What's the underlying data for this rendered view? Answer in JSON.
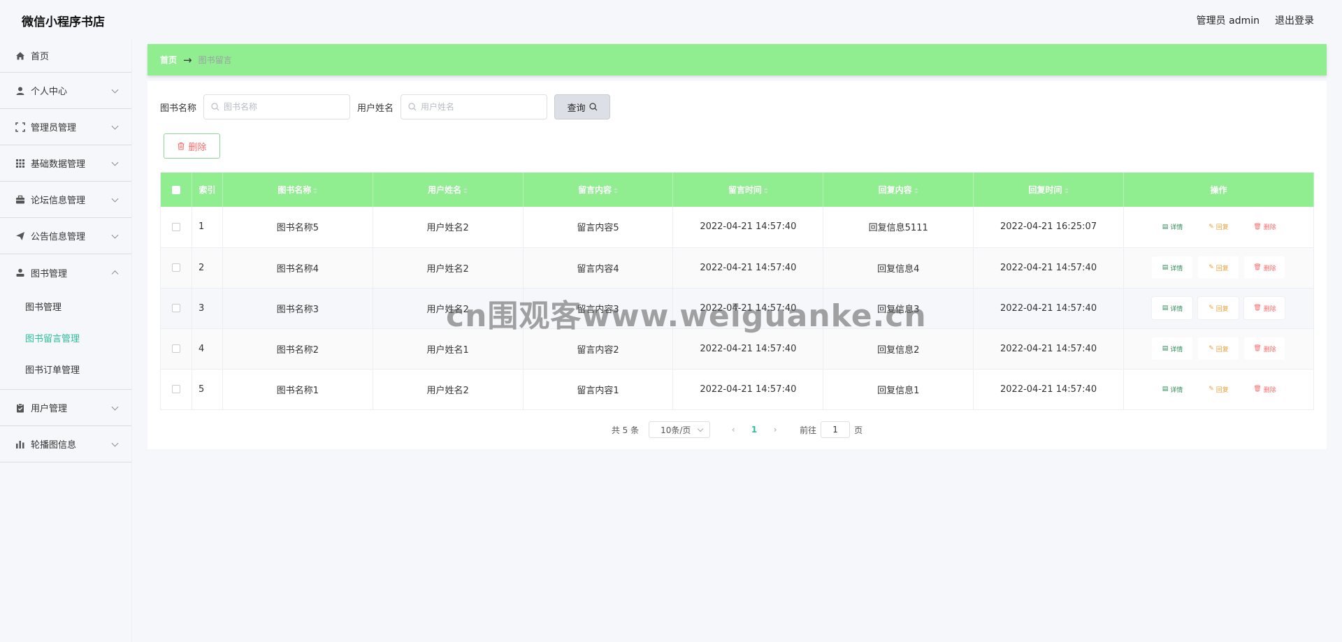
{
  "app": {
    "title": "微信小程序书店"
  },
  "header": {
    "user_label": "管理员 admin",
    "logout_label": "退出登录"
  },
  "sidebar": {
    "items": [
      {
        "label": "首页",
        "icon": "home-icon"
      },
      {
        "label": "个人中心",
        "icon": "user-icon"
      },
      {
        "label": "管理员管理",
        "icon": "frame-icon"
      },
      {
        "label": "基础数据管理",
        "icon": "grid-icon"
      },
      {
        "label": "论坛信息管理",
        "icon": "briefcase-icon"
      },
      {
        "label": "公告信息管理",
        "icon": "paper-plane-icon"
      },
      {
        "label": "图书管理",
        "icon": "user-badge-icon"
      },
      {
        "label": "用户管理",
        "icon": "clipboard-icon"
      },
      {
        "label": "轮播图信息",
        "icon": "bar-chart-icon"
      }
    ],
    "book_submenu": [
      {
        "label": "图书管理"
      },
      {
        "label": "图书留言管理",
        "active": true
      },
      {
        "label": "图书订单管理"
      }
    ]
  },
  "breadcrumb": {
    "home": "首页",
    "separator": "→",
    "current": "图书留言"
  },
  "search": {
    "book_label": "图书名称",
    "book_placeholder": "图书名称",
    "user_label": "用户姓名",
    "user_placeholder": "用户姓名",
    "query_label": "查询"
  },
  "toolbar": {
    "delete_label": "删除"
  },
  "table": {
    "headers": [
      "索引",
      "图书名称",
      "用户姓名",
      "留言内容",
      "留言时间",
      "回复内容",
      "回复时间",
      "操作"
    ],
    "rows": [
      {
        "index": "1",
        "book": "图书名称5",
        "user": "用户姓名2",
        "content": "留言内容5",
        "time": "2022-04-21 14:57:40",
        "reply": "回复信息5111",
        "reply_time": "2022-04-21 16:25:07"
      },
      {
        "index": "2",
        "book": "图书名称4",
        "user": "用户姓名2",
        "content": "留言内容4",
        "time": "2022-04-21 14:57:40",
        "reply": "回复信息4",
        "reply_time": "2022-04-21 14:57:40"
      },
      {
        "index": "3",
        "book": "图书名称3",
        "user": "用户姓名2",
        "content": "留言内容3",
        "time": "2022-04-21 14:57:40",
        "reply": "回复信息3",
        "reply_time": "2022-04-21 14:57:40"
      },
      {
        "index": "4",
        "book": "图书名称2",
        "user": "用户姓名1",
        "content": "留言内容2",
        "time": "2022-04-21 14:57:40",
        "reply": "回复信息2",
        "reply_time": "2022-04-21 14:57:40"
      },
      {
        "index": "5",
        "book": "图书名称1",
        "user": "用户姓名2",
        "content": "留言内容1",
        "time": "2022-04-21 14:57:40",
        "reply": "回复信息1",
        "reply_time": "2022-04-21 14:57:40"
      }
    ],
    "actions": {
      "detail": "详情",
      "reply": "回复",
      "delete": "删除"
    }
  },
  "pagination": {
    "total": "共 5 条",
    "page_size": "10条/页",
    "current_page": "1",
    "prev": "‹",
    "next": "›",
    "goto_prefix": "前往",
    "goto_value": "1",
    "goto_suffix": "页"
  },
  "watermark": "cn围观客www.weiguanke.cn",
  "colors": {
    "accent": "#90ee90",
    "active_menu": "#2bbf9c",
    "danger": "#f56c6c",
    "warning": "#e6a23c",
    "success": "#2e8b57"
  }
}
